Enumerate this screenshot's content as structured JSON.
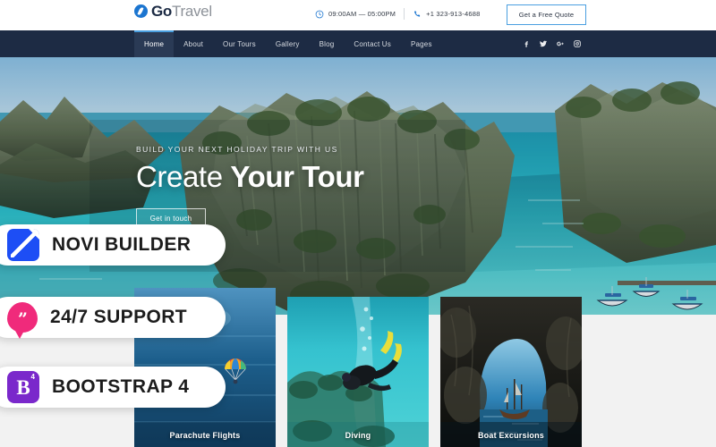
{
  "brand": {
    "logo_icon": "compass-icon",
    "name_bold": "Go",
    "name_light": "Travel",
    "accent_color": "#1b75d0",
    "navy_color": "#1d2b44"
  },
  "topbar": {
    "hours_icon": "clock-icon",
    "hours": "09:00AM — 05:00PM",
    "phone_icon": "phone-icon",
    "phone": "+1 323-913-4688",
    "quote_button": "Get a Free Quote"
  },
  "nav": {
    "items": [
      {
        "label": "Home",
        "active": true
      },
      {
        "label": "About",
        "active": false
      },
      {
        "label": "Our Tours",
        "active": false
      },
      {
        "label": "Gallery",
        "active": false
      },
      {
        "label": "Blog",
        "active": false
      },
      {
        "label": "Contact Us",
        "active": false
      },
      {
        "label": "Pages",
        "active": false
      }
    ],
    "social": [
      {
        "name": "facebook-icon"
      },
      {
        "name": "twitter-icon"
      },
      {
        "name": "google-plus-icon"
      },
      {
        "name": "instagram-icon"
      }
    ]
  },
  "hero": {
    "kicker": "BUILD YOUR NEXT HOLIDAY TRIP WITH US",
    "title_light": "Create ",
    "title_bold": "Your Tour",
    "cta": "Get in touch"
  },
  "badges": [
    {
      "icon": "novi-builder-icon",
      "label": "NOVI BUILDER",
      "color": "#1d4ef5"
    },
    {
      "icon": "speech-bubble-icon",
      "label": "24/7 SUPPORT",
      "color": "#f02a7b"
    },
    {
      "icon": "bootstrap-icon",
      "label": "BOOTSTRAP 4",
      "color": "#7a28cb"
    }
  ],
  "cards": [
    {
      "label": "Parachute Flights"
    },
    {
      "label": "Diving"
    },
    {
      "label": "Boat Excursions"
    }
  ]
}
